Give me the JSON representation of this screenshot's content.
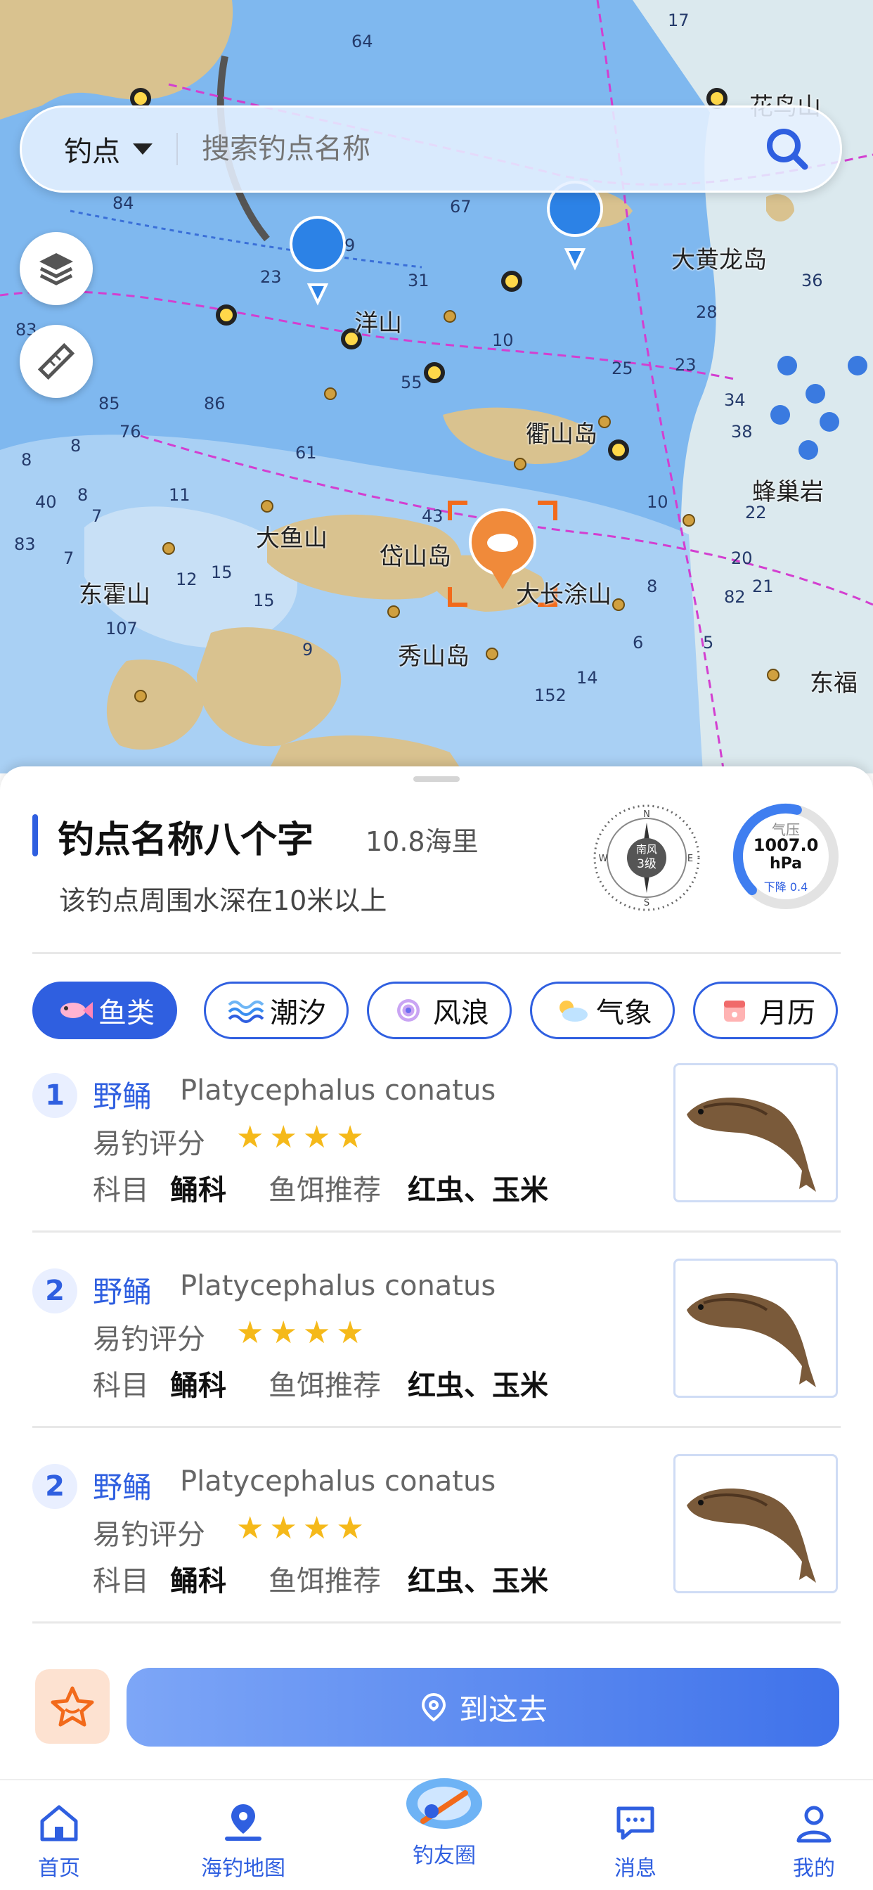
{
  "map": {
    "labels": [
      "大黄龙岛",
      "洋山",
      "衢山岛",
      "蜂巢岩",
      "大鱼山",
      "岱山岛",
      "大长涂山",
      "东霍山",
      "秀山岛",
      "东福",
      "花鸟山"
    ],
    "depths": [
      "84",
      "9",
      "23",
      "31",
      "83",
      "10",
      "25",
      "85",
      "8",
      "55",
      "86",
      "23",
      "34",
      "76",
      "8",
      "61",
      "22",
      "8",
      "83",
      "7",
      "40",
      "7",
      "82",
      "10",
      "15",
      "15",
      "9",
      "43",
      "6",
      "5",
      "11",
      "8",
      "20",
      "107",
      "64",
      "12",
      "14",
      "21",
      "152",
      "38",
      "28",
      "36",
      "67",
      "17"
    ]
  },
  "search": {
    "type_label": "钓点",
    "placeholder": "搜索钓点名称"
  },
  "spot": {
    "name": "钓点名称八个字",
    "distance": "10.8海里",
    "description": "该钓点周围水深在10米以上",
    "wind_label": "南风",
    "wind_level": "3级",
    "compass_n": "N",
    "compass_s": "S",
    "compass_e": "E",
    "compass_w": "W",
    "pressure_label": "气压",
    "pressure_value": "1007.0",
    "pressure_unit": "hPa",
    "pressure_trend": "下降 0.4",
    "pressure_level": 0.55
  },
  "tabs": [
    {
      "label": "鱼类",
      "icon": "fish-icon"
    },
    {
      "label": "潮汐",
      "icon": "wave-icon"
    },
    {
      "label": "风浪",
      "icon": "swirl-icon"
    },
    {
      "label": "气象",
      "icon": "weather-icon"
    },
    {
      "label": "月历",
      "icon": "calendar-icon"
    }
  ],
  "fish": [
    {
      "rank": "1",
      "name": "野鲬",
      "latin": "Platycephalus conatus",
      "rating_label": "易钓评分",
      "stars": 4,
      "family_label": "科目",
      "family": "鲬科",
      "bait_label": "鱼饵推荐",
      "bait": "红虫、玉米"
    },
    {
      "rank": "2",
      "name": "野鲬",
      "latin": "Platycephalus conatus",
      "rating_label": "易钓评分",
      "stars": 4,
      "family_label": "科目",
      "family": "鲬科",
      "bait_label": "鱼饵推荐",
      "bait": "红虫、玉米"
    },
    {
      "rank": "2",
      "name": "野鲬",
      "latin": "Platycephalus conatus",
      "rating_label": "易钓评分",
      "stars": 4,
      "family_label": "科目",
      "family": "鲬科",
      "bait_label": "鱼饵推荐",
      "bait": "红虫、玉米"
    }
  ],
  "actions": {
    "go_label": "到这去"
  },
  "tabbar": [
    {
      "label": "首页",
      "icon": "home-icon"
    },
    {
      "label": "海钓地图",
      "icon": "map-pin-icon"
    },
    {
      "label": "钓友圈",
      "icon": "community-icon"
    },
    {
      "label": "消息",
      "icon": "message-icon"
    },
    {
      "label": "我的",
      "icon": "profile-icon"
    }
  ],
  "colors": {
    "accent": "#2f5fe0",
    "star": "#f5b91a",
    "land": "#d9c28f",
    "sea": "#8ec3f2",
    "marker": "#f08a3a"
  }
}
